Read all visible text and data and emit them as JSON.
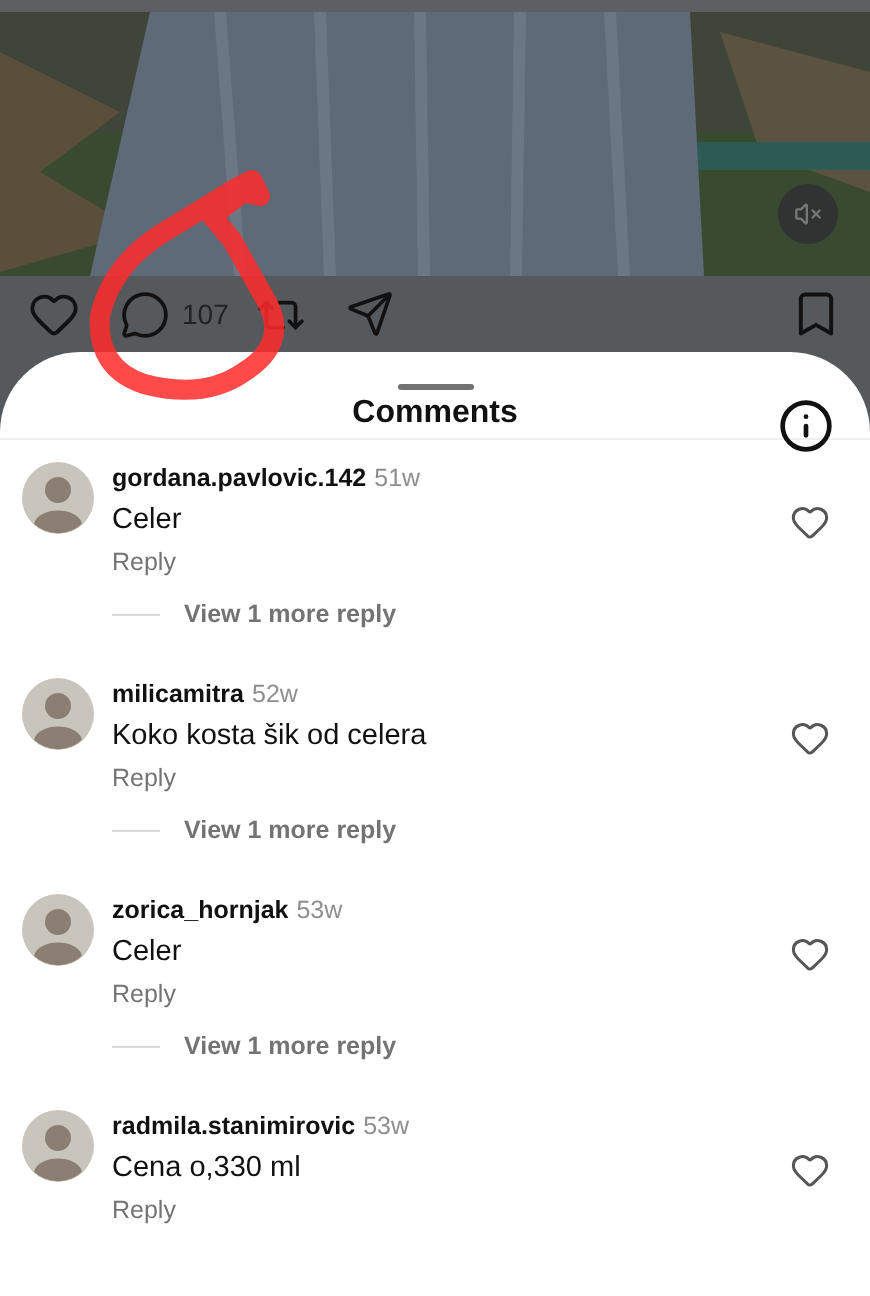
{
  "post": {
    "comment_count": "107"
  },
  "sheet": {
    "title": "Comments"
  },
  "comments": [
    {
      "username": "gordana.pavlovic.142",
      "age": "51w",
      "text": "Celer",
      "reply_label": "Reply",
      "more_replies": "View 1 more reply"
    },
    {
      "username": "milicamitra",
      "age": "52w",
      "text": "Koko kosta šik od celera",
      "reply_label": "Reply",
      "more_replies": "View 1 more reply"
    },
    {
      "username": "zorica_hornjak",
      "age": "53w",
      "text": "Celer",
      "reply_label": "Reply",
      "more_replies": "View 1 more reply"
    },
    {
      "username": "radmila.stanimirovic",
      "age": "53w",
      "text": "Cena o,330 ml",
      "reply_label": "Reply"
    }
  ]
}
